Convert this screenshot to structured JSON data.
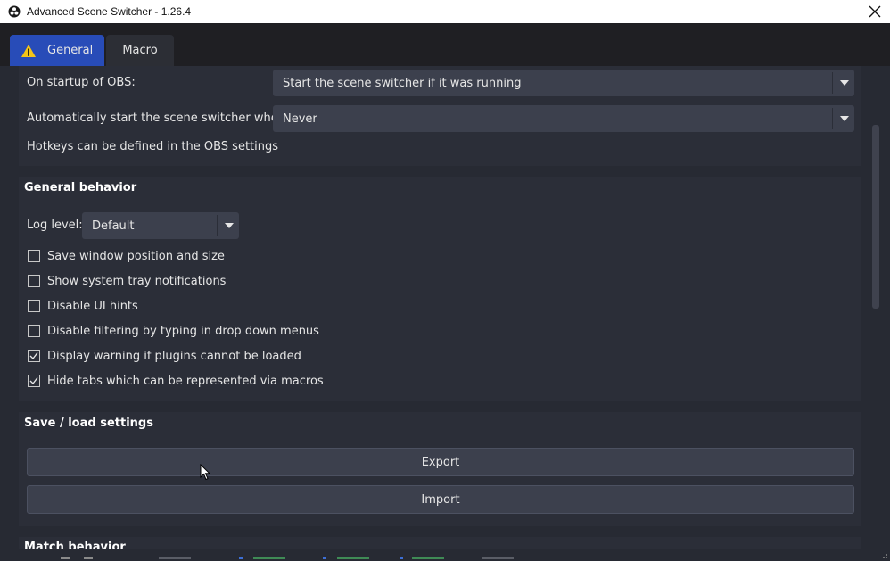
{
  "window": {
    "title": "Advanced Scene Switcher - 1.26.4"
  },
  "tabs": [
    {
      "label": "General",
      "active": true,
      "icon": "warning-icon"
    },
    {
      "label": "Macro",
      "active": false
    }
  ],
  "startup": {
    "on_startup_label": "On startup of OBS:",
    "on_startup_value": "Start the scene switcher if it was running",
    "auto_start_label": "Automatically start the scene switcher when:",
    "auto_start_value": "Never",
    "hotkeys_hint": "Hotkeys can be defined in the OBS settings"
  },
  "general_behavior": {
    "heading": "General behavior",
    "log_level_label": "Log level:",
    "log_level_value": "Default",
    "checkboxes": [
      {
        "label": "Save window position and size",
        "checked": false
      },
      {
        "label": "Show system tray notifications",
        "checked": false
      },
      {
        "label": "Disable UI hints",
        "checked": false
      },
      {
        "label": "Disable filtering by typing in drop down menus",
        "checked": false
      },
      {
        "label": "Display warning if plugins cannot be loaded",
        "checked": true
      },
      {
        "label": "Hide tabs which can be represented via macros",
        "checked": true
      }
    ]
  },
  "save_load": {
    "heading": "Save / load settings",
    "export_label": "Export",
    "import_label": "Import"
  },
  "match_behavior": {
    "heading": "Match behavior"
  },
  "colors": {
    "active_tab": "#284cb8",
    "panel": "#2b2e38",
    "background": "#272a33",
    "control": "#3c404d",
    "warning": "#f5c518"
  }
}
